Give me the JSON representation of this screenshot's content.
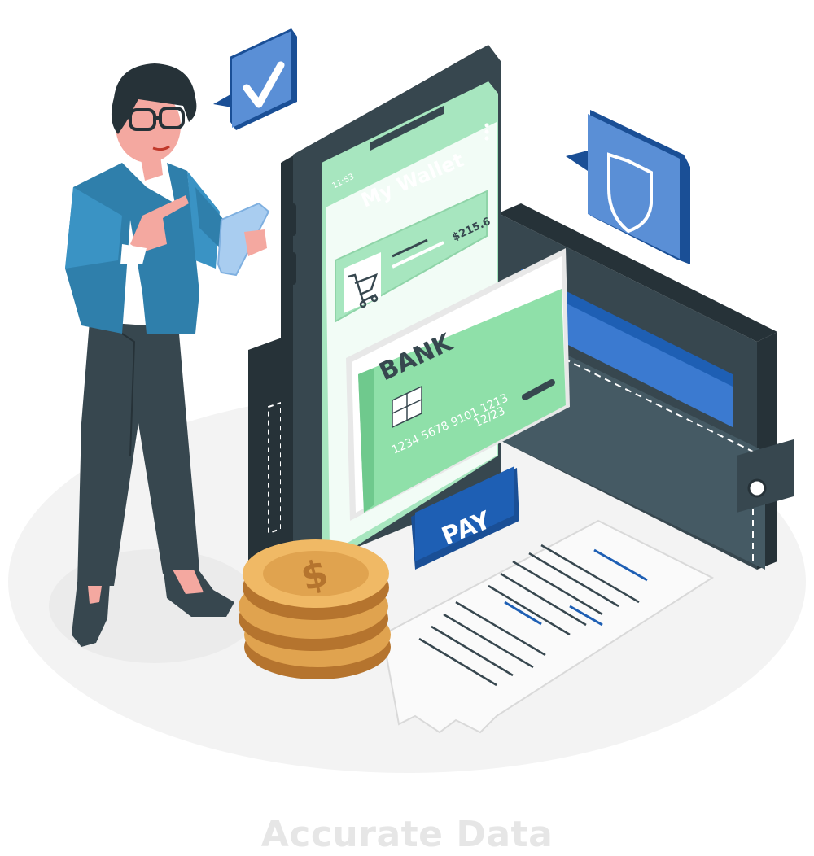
{
  "caption": "Accurate Data",
  "phone": {
    "status_time": "11:53",
    "title": "My Wallet",
    "amount": "$215.6"
  },
  "card": {
    "bank_name": "BANK",
    "number": "1234 5678 9101 1213",
    "expiry": "12/23"
  },
  "pay_button": "PAY",
  "colors": {
    "phone_body": "#37474f",
    "screen_green": "#a7e6bf",
    "card_green": "#8fe0a9",
    "accent_blue": "#1e5fb4",
    "wallet_dark": "#37474f",
    "coin_gold": "#e0a34f"
  }
}
